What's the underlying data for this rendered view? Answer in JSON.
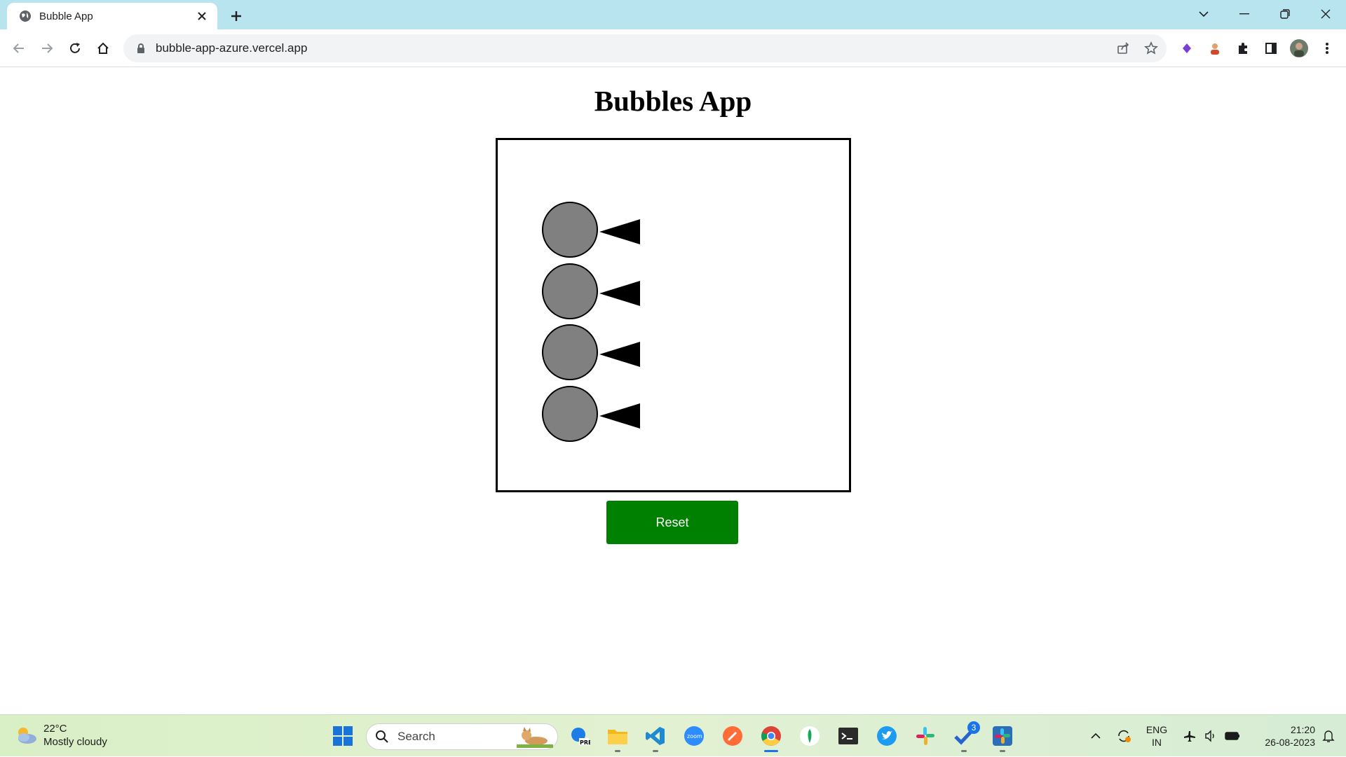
{
  "browser": {
    "tab_title": "Bubble App",
    "url": "bubble-app-azure.vercel.app"
  },
  "page": {
    "title": "Bubbles App",
    "reset_label": "Reset",
    "bubbles": [
      {
        "color": "#808080",
        "arrow_color": "#000000"
      },
      {
        "color": "#808080",
        "arrow_color": "#000000"
      },
      {
        "color": "#808080",
        "arrow_color": "#000000"
      },
      {
        "color": "#808080",
        "arrow_color": "#000000"
      }
    ],
    "reset_color": "#008000"
  },
  "taskbar": {
    "weather_temp": "22°C",
    "weather_desc": "Mostly cloudy",
    "search_placeholder": "Search",
    "todo_badge": "3",
    "lang_top": "ENG",
    "lang_bottom": "IN",
    "time": "21:20",
    "date": "26-08-2023"
  }
}
